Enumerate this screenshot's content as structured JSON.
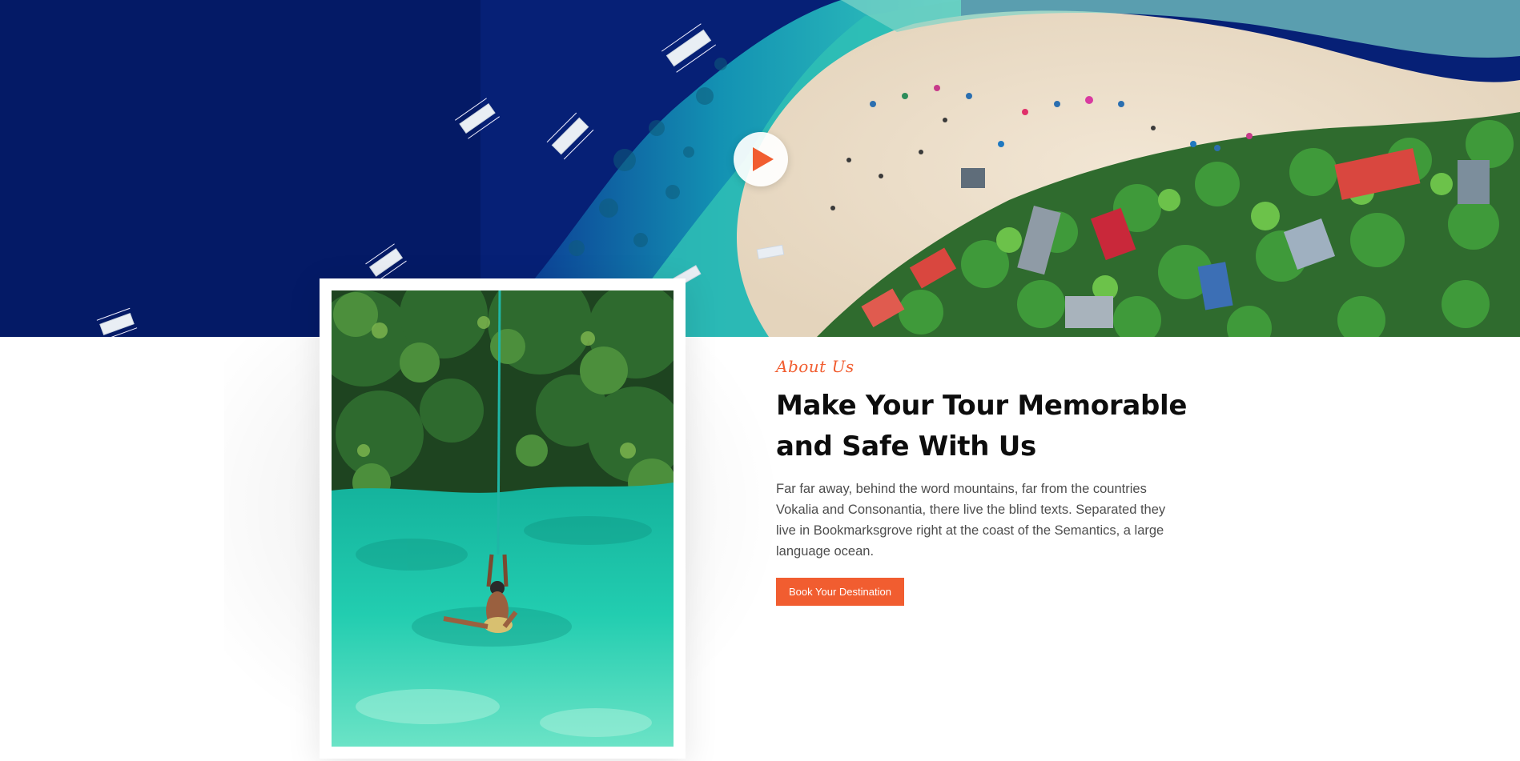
{
  "hero": {
    "play_button_icon": "play-icon",
    "accent_color": "#f15d30"
  },
  "about": {
    "eyebrow": "About Us",
    "headline_line1": "Make Your Tour Memorable",
    "headline_line2": "and Safe With Us",
    "description": "Far far away, behind the word mountains, far from the countries Vokalia and Consonantia, there live the blind texts. Separated they live in Bookmarksgrove right at the coast of the Semantics, a large language ocean.",
    "cta_label": "Book Your Destination"
  }
}
